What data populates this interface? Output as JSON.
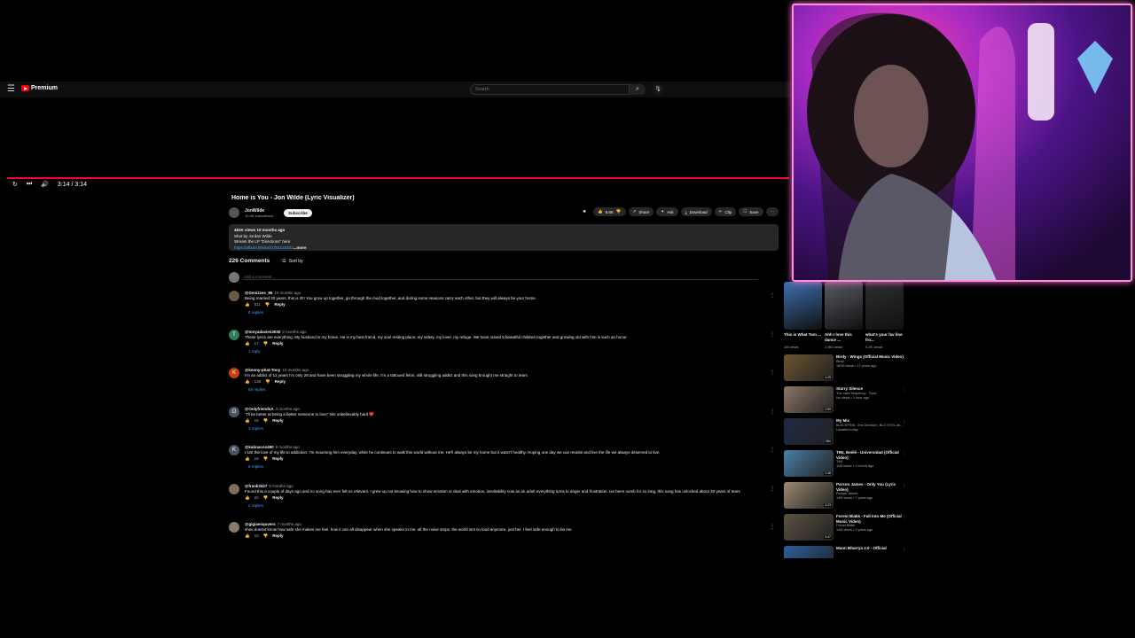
{
  "header": {
    "logo_text": "Premium",
    "search_placeholder": "Search"
  },
  "player": {
    "time": "3:14 / 3:14",
    "progress_percent": 100
  },
  "video": {
    "title": "Home is You - Jon Wilde (Lyric Visualizer)",
    "channel": "JonWilde",
    "subscribers": "10.4K subscribers",
    "subscribe_label": "Subscribe",
    "like_count": "8.8K",
    "share_label": "Share",
    "ask_label": "Ask",
    "download_label": "Download",
    "clip_label": "Clip",
    "save_label": "Save",
    "desc_stats": "481K views  10 months ago",
    "desc_line1": "Shot by Jordan Wilde",
    "desc_line2": "Stream the LP \"Directions\" here",
    "desc_link": "https://album.link/us/i1751123323",
    "desc_more": "...more"
  },
  "comments": {
    "count_label": "226 Comments",
    "sort_label": "Sort by",
    "add_placeholder": "Add a comment...",
    "items": [
      {
        "avatar": "",
        "color": "#6b5a4a",
        "user": "@Genizzes_85",
        "time": "10 months ago",
        "text": "Being married 20 years, this is it!!! You grow up together, go through the mud together, and during some seasons carry each other, but they will always be your home.",
        "likes": "511",
        "replies": "8 replies"
      },
      {
        "avatar": "T",
        "color": "#2e7d5b",
        "user": "@tonyadavies3030",
        "time": "2 months ago",
        "text": "These lyrics are everything. My husband is my home. He is my best friend, my soul resting place, my safety, my lover, my refuge. We have raised 5 beautiful children together and growing old with him is such an honor.",
        "likes": "17",
        "replies": "1 reply"
      },
      {
        "avatar": "K",
        "color": "#c2410c",
        "user": "@kenny-phat-Tony",
        "time": "10 months ago",
        "text": "I'm an addict of 12 years I'm only 28 and have been struggling my whole life. I'm a tattooed felon, still struggling addict and this song brought me straight to tears",
        "likes": "138",
        "replies": "55 replies"
      },
      {
        "avatar": "O",
        "color": "#4b5563",
        "user": "@OnlyfriendsA",
        "time": "3 months ago",
        "text": "\"I'll be better at being a better someone to love\" hits unbelievably hard ❤️",
        "likes": "15",
        "replies": "3 replies"
      },
      {
        "avatar": "K",
        "color": "#4b5563",
        "user": "@katinacox490",
        "time": "8 months ago",
        "text": "I lost the love of my life to addiction. I'm mourning him everyday, while he continues to walk this world without me. He'll always be my home but it wasn't healthy. Hoping one day we can reunite and live the life we always deserved to live.",
        "likes": "16",
        "replies": "5 replies"
      },
      {
        "avatar": "",
        "color": "#7c6f5f",
        "user": "@frank3427",
        "time": "6 months ago",
        "text": "Found this a couple of days ago and no song has ever felt so relevant. I grew up not knowing how to show emotion or deal with emotion, inevitability now as an adult everything turns to anger and frustration. Ive been numb for so long, this song has unlocked about 20 years of tears",
        "likes": "22",
        "replies": "2 replies"
      },
      {
        "avatar": "",
        "color": "#8a7a6a",
        "user": "@gigiaesquvers",
        "time": "7 months ago",
        "text": "shes doesnt know how safe she makes me feel. how it can all disappear when she speaks to me. all the noise stops. the world isnt so loud anymore. just her. I feel safe enough to be me",
        "likes": "10",
        "replies": ""
      }
    ]
  },
  "sidebar": {
    "shorts": [
      {
        "title": "This is What Tom ...",
        "views": "1M views",
        "color": "#3d6fb0"
      },
      {
        "title": "Ahh I love this dance ...",
        "views": "1.9M views",
        "color": "#5a5a64"
      },
      {
        "title": "what's your fav line fro...",
        "views": "5.2K views",
        "color": "#2e2e2e"
      }
    ],
    "videos": [
      {
        "title": "Birdy - Wings (Official Music Video)",
        "channel": "Birdy",
        "meta": "182M views • 12 years ago",
        "duration": "4:25",
        "color": "#6b5530"
      },
      {
        "title": "Starry Silence",
        "channel": "The calm frequency - Topic",
        "meta": "No views • 1 hour ago",
        "duration": "2:59",
        "color": "#8a7766"
      },
      {
        "title": "My Mix",
        "channel": "BLACKPINK, One Direction, BLG SYEL an...",
        "meta": "Updated today",
        "duration": "Mix",
        "color": "#1f2a44"
      },
      {
        "title": "TINI, Beélé - Universidad (Official Video)",
        "channel": "TINI",
        "meta": "11M views • 1 month ago",
        "duration": "2:48",
        "color": "#4a7fa8"
      },
      {
        "title": "Parson James - Only You (Lyric Video)",
        "channel": "Parson James",
        "meta": "14M views • 7 years ago",
        "duration": "3:23",
        "color": "#9a8a70"
      },
      {
        "title": "Forest Blakk - Fall Into Me (Official Music Video)",
        "channel": "Forest Blakk",
        "meta": "14M views • 3 years ago",
        "duration": "3:47",
        "color": "#5a5040"
      },
      {
        "title": "Mann Bharrya 2.0 - Official",
        "channel": "",
        "meta": "",
        "duration": "",
        "color": "#2b5fa0"
      }
    ]
  }
}
